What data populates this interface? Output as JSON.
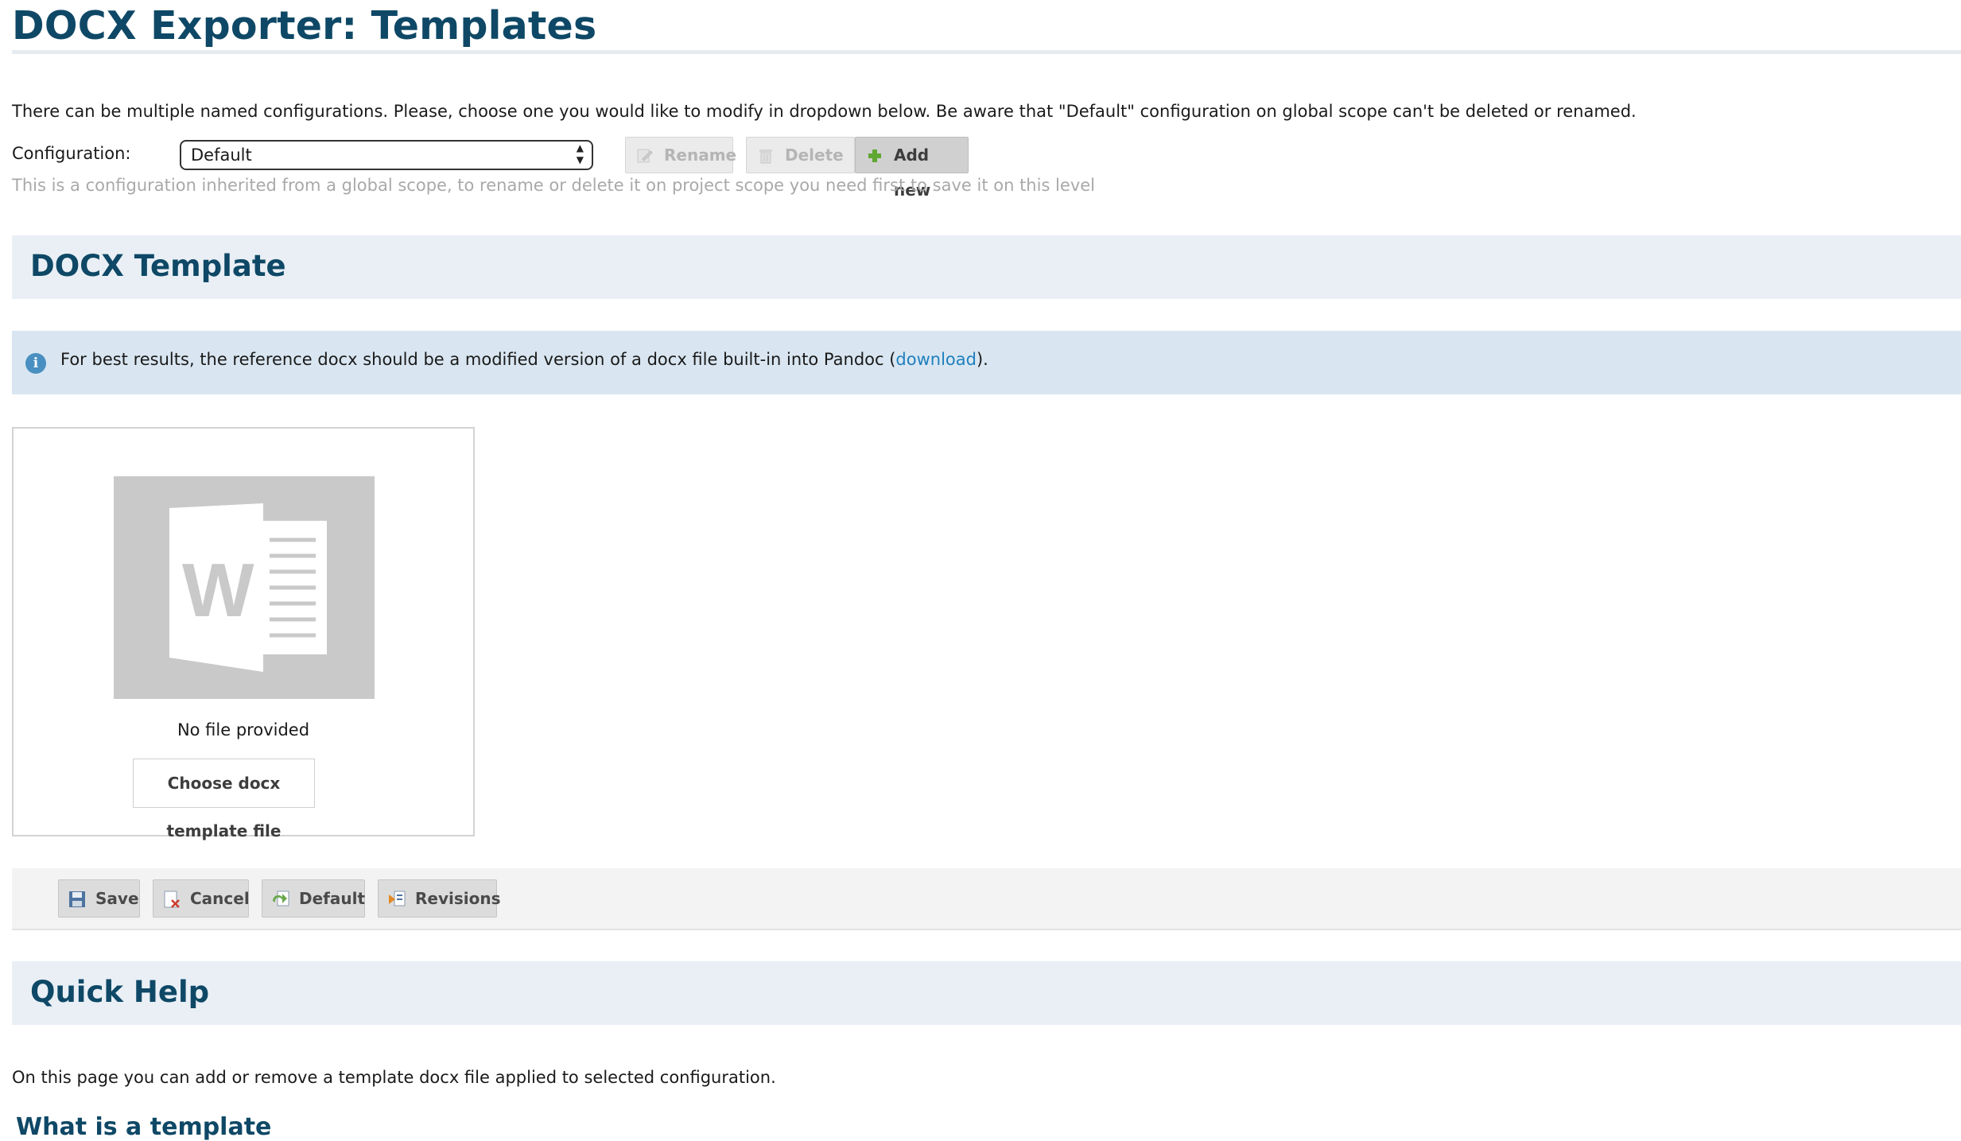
{
  "page": {
    "title": "DOCX Exporter: Templates",
    "intro": "There can be multiple named configurations. Please, choose one you would like to modify in dropdown below. Be aware that \"Default\" configuration on global scope can't be deleted or renamed."
  },
  "config": {
    "label": "Configuration:",
    "selected": "Default",
    "rename_label": "Rename",
    "delete_label": "Delete",
    "addnew_label": "Add new",
    "inherited_note": "This is a configuration inherited from a global scope, to rename or delete it on project scope you need first to save it on this level"
  },
  "template_section": {
    "heading": "DOCX Template",
    "info_text_before": "For best results, the reference docx should be a modified version of a docx file built-in into Pandoc (",
    "info_link": "download",
    "info_text_after": ").",
    "preview_icon": "word-document-icon",
    "no_file": "No file provided",
    "choose_label": "Choose docx template file"
  },
  "actions": {
    "save_label": "Save",
    "cancel_label": "Cancel",
    "default_label": "Default",
    "revisions_label": "Revisions"
  },
  "help": {
    "heading": "Quick Help",
    "text": "On this page you can add or remove a template docx file applied to selected configuration.",
    "subheading": "What is a template"
  },
  "colors": {
    "heading": "#0e4866",
    "link": "#1f7fbe",
    "section_bg": "#e9eff5",
    "info_bg": "#d9e6f1"
  }
}
